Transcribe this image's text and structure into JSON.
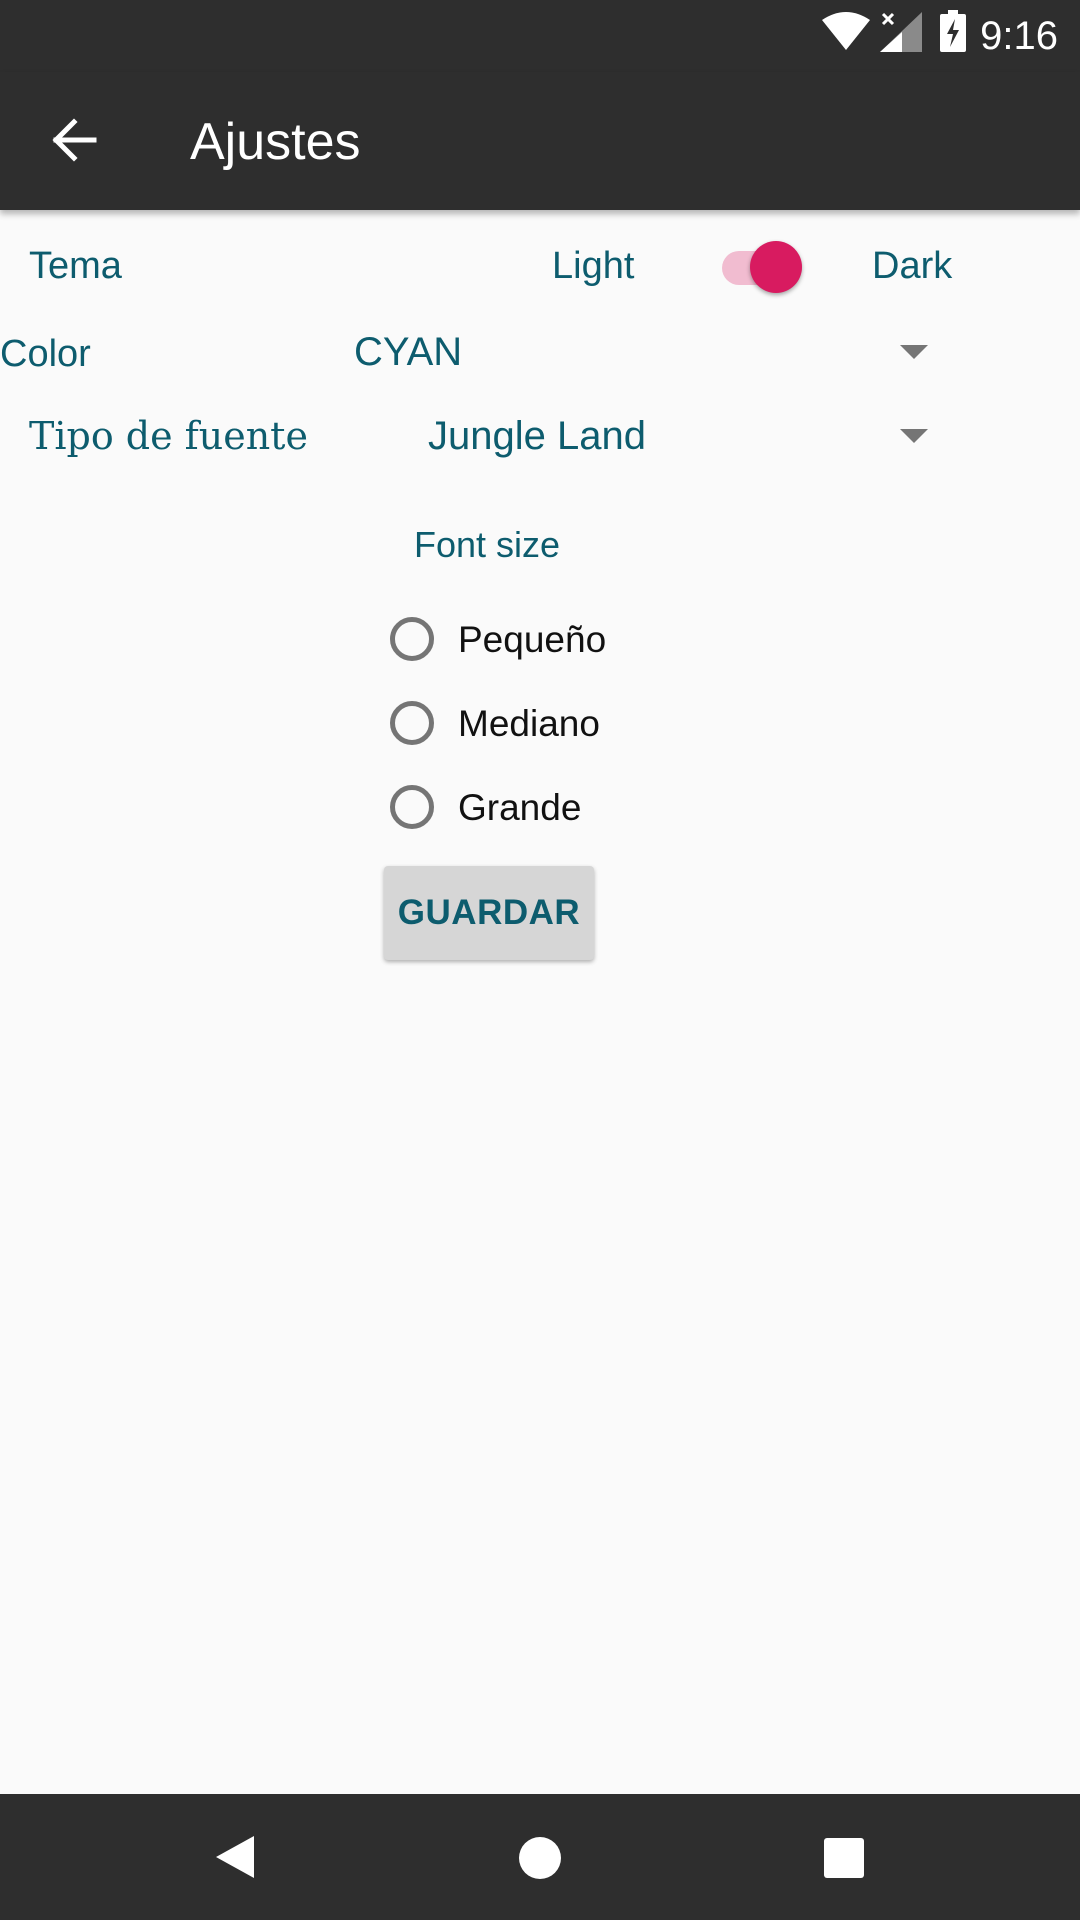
{
  "status_bar": {
    "time": "9:16",
    "icons": [
      "wifi-icon",
      "signal-icon",
      "battery-charging-icon"
    ]
  },
  "app_bar": {
    "back_icon": "arrow-back-icon",
    "title": "Ajustes"
  },
  "settings": {
    "theme": {
      "label": "Tema",
      "option_light": "Light",
      "option_dark": "Dark",
      "dark_enabled": true,
      "accent_color": "#d81b60"
    },
    "color": {
      "label": "Color",
      "selected": "CYAN"
    },
    "font_type": {
      "label": "Tipo de fuente",
      "selected": "Jungle Land"
    },
    "font_size": {
      "label": "Font size",
      "options": [
        "Pequeño",
        "Mediano",
        "Grande"
      ],
      "selected": null
    },
    "save_label": "GUARDAR"
  },
  "colors": {
    "bar_background": "#2e2e2e",
    "text_teal": "#0d5c6e",
    "page_background": "#fafafa"
  },
  "nav_bar": {
    "icons": [
      "nav-back-icon",
      "nav-home-icon",
      "nav-recents-icon"
    ]
  }
}
